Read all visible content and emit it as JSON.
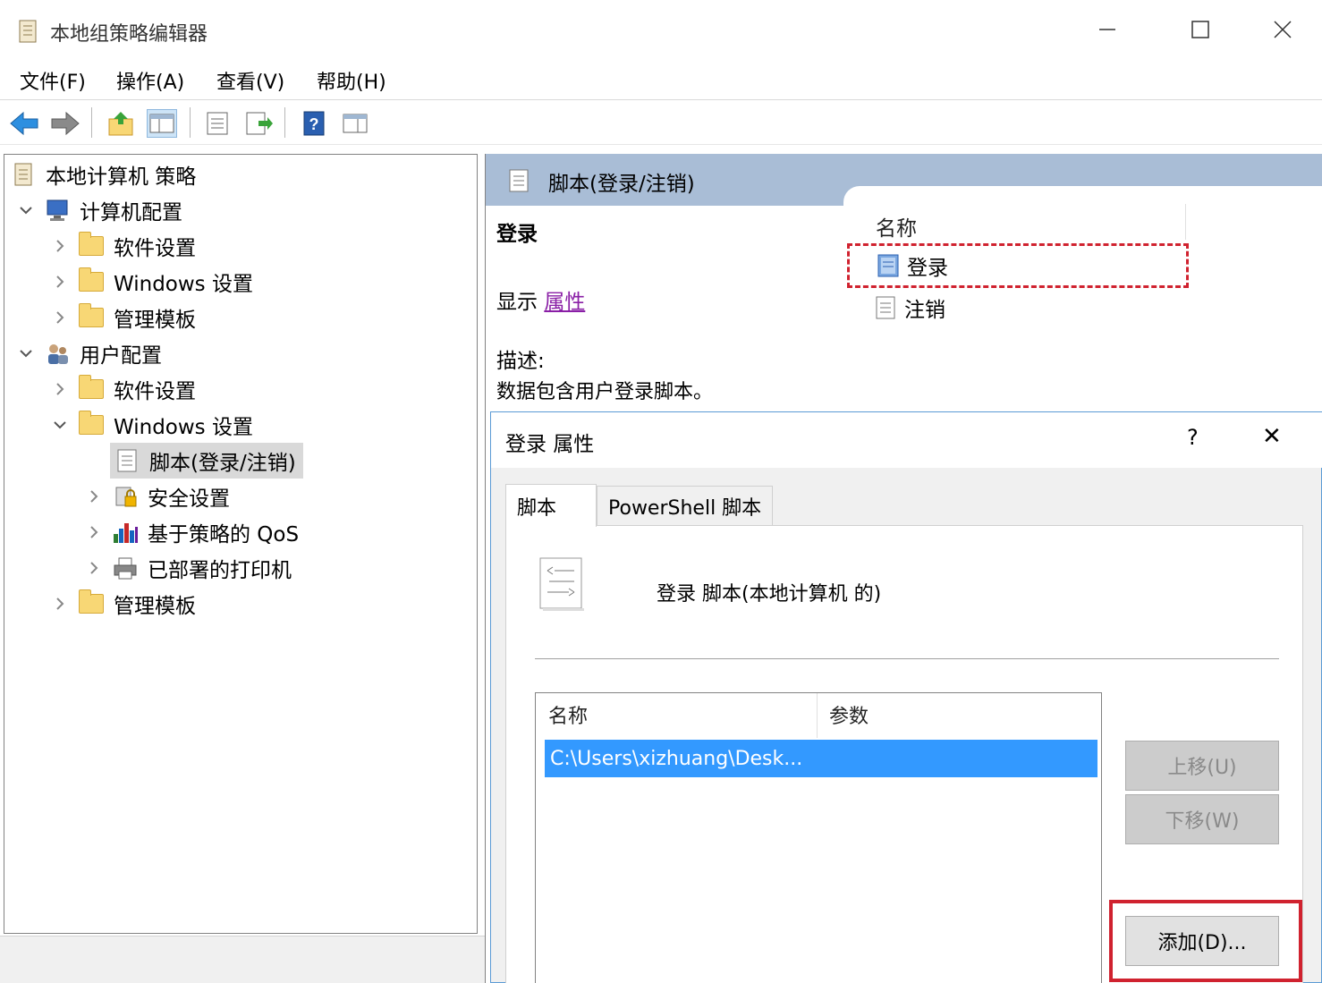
{
  "window": {
    "title": "本地组策略编辑器"
  },
  "menu": {
    "items": [
      "文件(F)",
      "操作(A)",
      "查看(V)",
      "帮助(H)"
    ]
  },
  "toolbar": {
    "icons": [
      "back-icon",
      "forward-icon",
      "up-folder-icon",
      "show-hide-tree-icon",
      "properties-icon",
      "export-list-icon",
      "help-icon",
      "action-pane-icon"
    ]
  },
  "tree": {
    "root": "本地计算机 策略",
    "computer_config": "计算机配置",
    "cc_software": "软件设置",
    "cc_windows": "Windows 设置",
    "cc_admin": "管理模板",
    "user_config": "用户配置",
    "uc_software": "软件设置",
    "uc_windows": "Windows 设置",
    "uc_scripts": "脚本(登录/注销)",
    "uc_security": "安全设置",
    "uc_qos": "基于策略的 QoS",
    "uc_printers": "已部署的打印机",
    "uc_admin": "管理模板"
  },
  "right_pane": {
    "header_title": "脚本(登录/注销)",
    "ext_title": "登录",
    "show_label": "显示",
    "properties_link": "属性",
    "desc_label": "描述:",
    "desc_text": "数据包含用户登录脚本。",
    "list_column": "名称",
    "items": [
      "登录",
      "注销"
    ]
  },
  "dialog": {
    "title": "登录 属性",
    "help": "?",
    "close": "✕",
    "tabs": [
      "脚本",
      "PowerShell 脚本"
    ],
    "heading": "登录 脚本(本地计算机 的)",
    "table_headers": [
      "名称",
      "参数"
    ],
    "table_rows": [
      {
        "name": "C:\\Users\\xizhuang\\Desk...",
        "params": ""
      }
    ],
    "buttons": {
      "up": "上移(U)",
      "down": "下移(W)",
      "add": "添加(D)..."
    }
  },
  "colors": {
    "header_bg": "#a9bdd6",
    "selection": "#3399ff",
    "highlight_red": "#d0222f",
    "link": "#8a1fa6"
  }
}
